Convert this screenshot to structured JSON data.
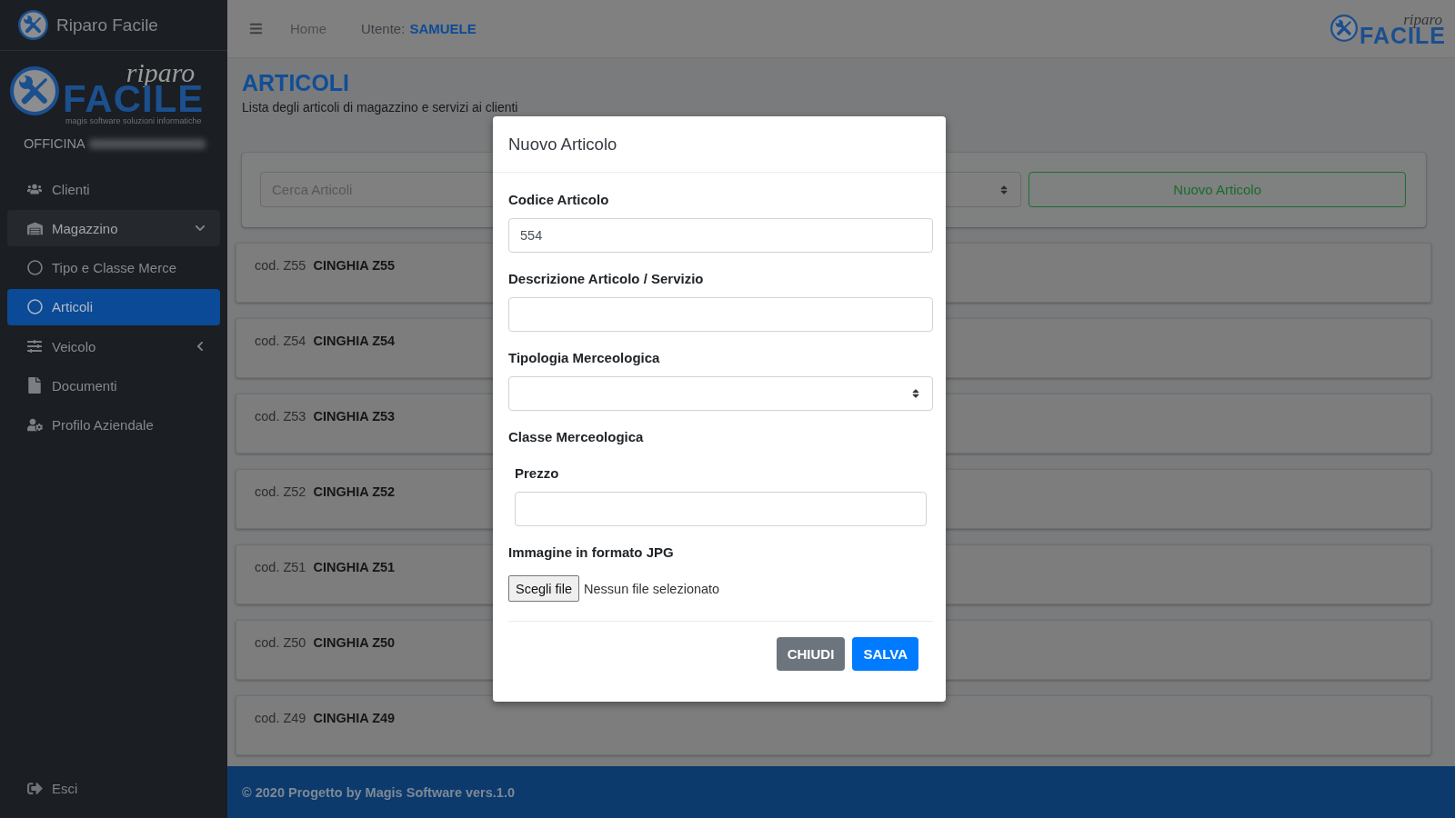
{
  "sidebar": {
    "brand": {
      "title": "Riparo Facile"
    },
    "logo": {
      "script": "riparo",
      "wordmark": "FACILE",
      "tagline": "magis software soluzioni informatiche"
    },
    "workshop": {
      "label": "OFFICINA",
      "name_blurred": true
    },
    "menu": [
      {
        "label": "Clienti",
        "selected": false
      },
      {
        "label": "Magazzino",
        "selected": false,
        "expanded": true,
        "children": [
          {
            "label": "Tipo e Classe Merce",
            "selected": false
          },
          {
            "label": "Articoli",
            "selected": true
          }
        ]
      },
      {
        "label": "Veicolo",
        "selected": false,
        "expanded": false
      },
      {
        "label": "Documenti",
        "selected": false
      },
      {
        "label": "Profilo Aziendale",
        "selected": false
      }
    ],
    "logout": {
      "label": "Esci"
    }
  },
  "header": {
    "nav": [
      {
        "label": "Home"
      }
    ],
    "user": {
      "label": "Utente:",
      "name": "SAMUELE"
    },
    "logo": {
      "script": "riparo",
      "wordmark": "FACILE"
    }
  },
  "page": {
    "title": "ARTICOLI",
    "subtitle": "Lista degli articoli di magazzino e servizi ai clienti"
  },
  "toolbar": {
    "search": {
      "placeholder": "Cerca Articoli"
    },
    "button": "Nuovo Articolo"
  },
  "articles": [
    {
      "code": "cod. Z55",
      "name": "CINGHIA Z55"
    },
    {
      "code": "cod. Z54",
      "name": "CINGHIA Z54"
    },
    {
      "code": "cod. Z53",
      "name": "CINGHIA Z53"
    },
    {
      "code": "cod. Z52",
      "name": "CINGHIA Z52"
    },
    {
      "code": "cod. Z51",
      "name": "CINGHIA Z51"
    },
    {
      "code": "cod. Z50",
      "name": "CINGHIA Z50"
    },
    {
      "code": "cod. Z49",
      "name": "CINGHIA Z49"
    }
  ],
  "footer": {
    "text": "© 2020 Progetto by Magis Software vers.1.0"
  },
  "modal": {
    "title": "Nuovo Articolo",
    "fields": [
      {
        "kind": "text",
        "label": "Codice Articolo",
        "value": "554"
      },
      {
        "kind": "text",
        "label": "Descrizione Articolo / Servizio"
      },
      {
        "kind": "select",
        "label": "Tipologia Merceologica"
      },
      {
        "kind": "heading",
        "label": "Classe Merceologica"
      },
      {
        "kind": "inset",
        "label": "Prezzo"
      },
      {
        "kind": "file",
        "label": "Immagine in formato JPG",
        "button": "Scegli file",
        "status": "Nessun file selezionato"
      }
    ],
    "buttons": [
      {
        "label": "CHIUDI",
        "kind": "secondary"
      },
      {
        "label": "SALVA",
        "kind": "primary"
      }
    ]
  }
}
